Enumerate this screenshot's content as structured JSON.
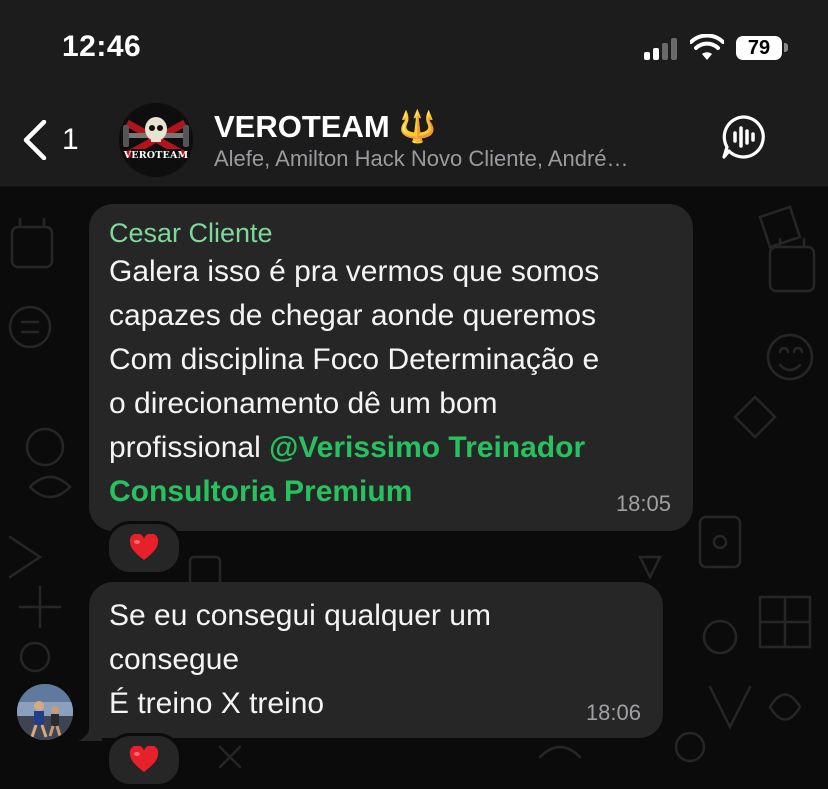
{
  "status_bar": {
    "time": "12:46",
    "battery": "79"
  },
  "header": {
    "back_count": "1",
    "group_title": "VEROTEAM 🔱",
    "group_members": "Alefe, Amilton Hack Novo Cliente, André…",
    "avatar_text": "VEROTEAM"
  },
  "messages": [
    {
      "sender": "Cesar Cliente",
      "lines": [
        "Galera isso é pra vermos que somos",
        "capazes de chegar aonde queremos",
        "Com disciplina Foco Determinação e",
        "o direcionamento dê um bom"
      ],
      "line_before_mention": "profissional ",
      "mention": "@Verissimo Treinador",
      "mention_line2": "Consultoria Premium",
      "time": "18:05",
      "reaction": "❤️"
    },
    {
      "lines": [
        "Se eu consegui qualquer um",
        "consegue",
        "É treino X treino"
      ],
      "time": "18:06",
      "reaction": "❤️"
    }
  ],
  "colors": {
    "header_bg": "#1c1c1d",
    "bubble_bg": "#262627",
    "sender_color": "#7dd89a",
    "mention_color": "#27c25f"
  }
}
